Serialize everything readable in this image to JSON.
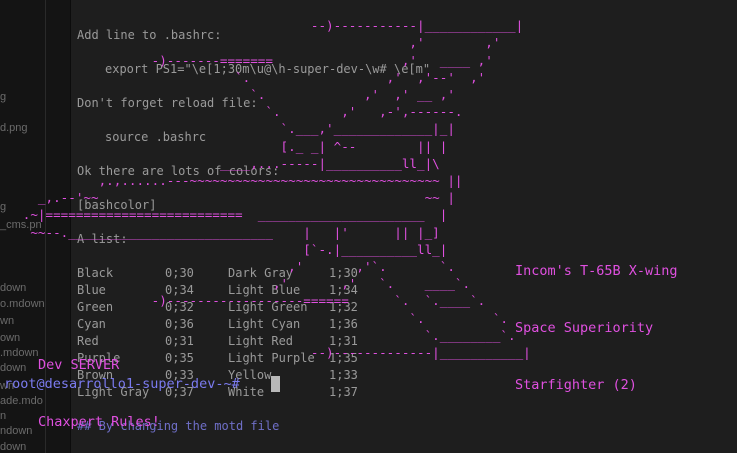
{
  "sidebar": {
    "items": [
      "g",
      "d.png",
      "g",
      "_cms.pn",
      "down",
      "o.mdown",
      "wn",
      "own",
      ".mdown",
      "down",
      "wn",
      "ade.mdo",
      "n",
      "ndown",
      "down"
    ]
  },
  "document": {
    "lines": [
      "Add line to .bashrc:",
      "export PS1=\"\\e[1;30m\\u@\\h-super-dev-\\w# \\e[m\"",
      "Don't forget reload file:",
      "source .bashrc",
      "Ok there are lots of colors:",
      "[bashcolor]",
      "A list:",
      "## By changing the motd file"
    ],
    "color_table": [
      [
        "Black",
        "0;30",
        "Dark Gray",
        "1;30"
      ],
      [
        "Blue",
        "0;34",
        "Light Blue",
        "1;34"
      ],
      [
        "Green",
        "0;32",
        "Light Green",
        "1;32"
      ],
      [
        "Cyan",
        "0;36",
        "Light Cyan",
        "1;36"
      ],
      [
        "Red",
        "0;31",
        "Light Red",
        "1;31"
      ],
      [
        "Purple",
        "0;35",
        "Light Purple",
        "1;35"
      ],
      [
        "Brown",
        "0;33",
        "Yellow",
        "1;33"
      ],
      [
        "Light Gray",
        "0;37",
        "White",
        "1;37"
      ]
    ]
  },
  "art": {
    "lines": [
      "",
      "                                         --)-----------|____________|",
      "                                                      ,'        ,'",
      "                    -)-------=======                 ,'   ____ ,'",
      "                               `.                  ,'  ,'--'  ,'",
      "                                 `.             ,'  ,' __ ,'",
      "                                   `.        ,'   ,-',------.",
      "                                     `.___,'_____________|_|",
      "                                     [._ _| ^--        || |",
      "                             ____,...-----|__________ll_|\\",
      "             ,.,......---~~~~~~~~~~~~~~~~~~~~~~~~~~~~~~~~~ ||",
      "     _,.--'~~                                           ~~ |",
      "   .~|==========================  ______________________  |",
      "    ~~--.___________________________    |   |'      || |_]",
      "                                        [`-.|__________ll_|",
      "                                      ,'       ,'`.       `.",
      "                                    ,'       ,'   `.    ____`.",
      "                    -)------------------======      `.  `.____`.",
      "                                                      `.         `.",
      "                                                        `.________`.",
      "                                         --)-------------|___________|"
    ],
    "labels": {
      "ship": [
        "Incom's T-65B X-wing",
        "Space Superiority",
        "Starfighter (2)"
      ],
      "server": [
        "Dev SERVER",
        "Chaxpert Rules!"
      ]
    }
  },
  "terminal": {
    "prompt": "root@desarrollo1-super-dev-~# "
  },
  "colors": {
    "art": "#e050e0",
    "prompt": "#7b7bf0",
    "background": "#1c1c1c",
    "doc_text": "#9a9a9a"
  }
}
